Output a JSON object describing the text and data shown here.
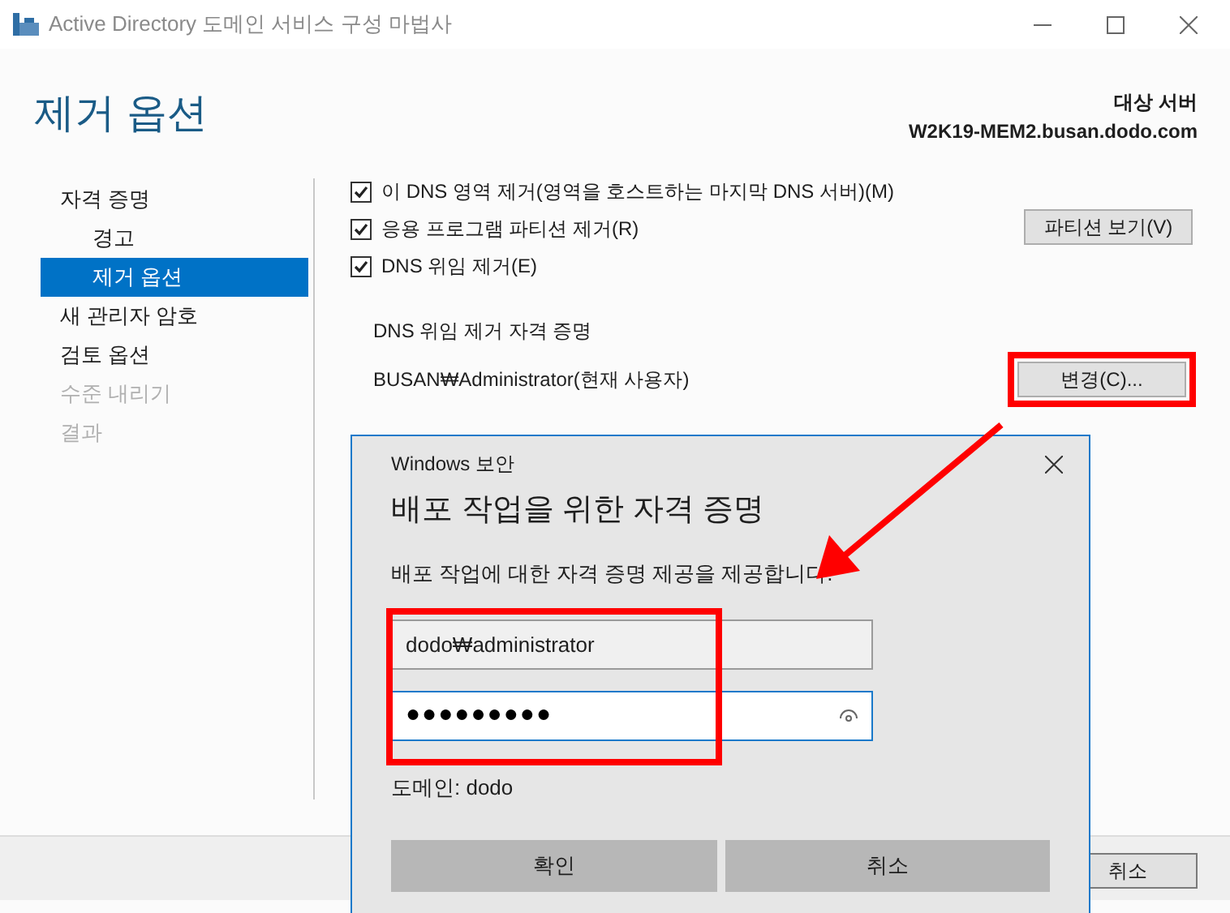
{
  "window": {
    "title": "Active Directory 도메인 서비스 구성 마법사"
  },
  "page": {
    "heading": "제거 옵션",
    "target_label": "대상 서버",
    "target_server": "W2K19-MEM2.busan.dodo.com"
  },
  "sidebar": {
    "items": [
      {
        "label": "자격 증명",
        "selected": false,
        "disabled": false,
        "children": [
          {
            "label": "경고",
            "selected": false,
            "disabled": false
          },
          {
            "label": "제거 옵션",
            "selected": true,
            "disabled": false
          }
        ]
      },
      {
        "label": "새 관리자 암호",
        "selected": false,
        "disabled": false
      },
      {
        "label": "검토 옵션",
        "selected": false,
        "disabled": false
      },
      {
        "label": "수준 내리기",
        "selected": false,
        "disabled": true
      },
      {
        "label": "결과",
        "selected": false,
        "disabled": true
      }
    ]
  },
  "options": [
    {
      "label": "이 DNS 영역 제거(영역을 호스트하는 마지막 DNS 서버)(M)",
      "checked": true
    },
    {
      "label": "응용 프로그램 파티션 제거(R)",
      "checked": true
    },
    {
      "label": "DNS 위임 제거(E)",
      "checked": true
    }
  ],
  "view_partitions_button": "파티션 보기(V)",
  "credentials": {
    "label": "DNS 위임 제거 자격 증명",
    "user": "BUSAN₩Administrator(현재 사용자)",
    "change_button": "변경(C)..."
  },
  "footer": {
    "cancel_button": "취소"
  },
  "dialog": {
    "title": "Windows 보안",
    "heading": "배포 작업을 위한 자격 증명",
    "prompt": "배포 작업에 대한 자격 증명 제공을 제공합니다.",
    "username": "dodo₩administrator",
    "password": "●●●●●●●●●",
    "domain": "도메인: dodo",
    "ok_button": "확인",
    "cancel_button": "취소"
  }
}
